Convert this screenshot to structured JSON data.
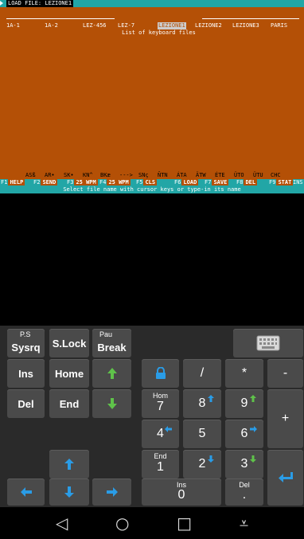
{
  "terminal": {
    "title": "LOAD FILE: LEZIONE1",
    "list_title": "List of keyboard files",
    "files": [
      "1A-1",
      "1A-2",
      "LEZ-456",
      "LEZ-7",
      "LEZIONE1",
      "LEZIONE2",
      "LEZIONE3",
      "PARIS"
    ],
    "selected_file": "LEZIONE1",
    "accents": [
      "ASß",
      "AR•",
      "SK•",
      "KN^",
      "BKæ",
      "--->",
      "SNç",
      "ÑTN",
      "ÁTA",
      "ÄTW",
      "ÉTE",
      "ÜTO",
      "ÜTU",
      "CHC"
    ],
    "function_keys": [
      {
        "num": "F1",
        "label": "HELP"
      },
      {
        "num": "F2",
        "label": "SEND"
      },
      {
        "num": "F3",
        "label": "25 WPM"
      },
      {
        "num": "F4",
        "label": "25 WPM"
      },
      {
        "num": "F5",
        "label": "CLS"
      },
      {
        "num": "F6",
        "label": "LOAD"
      },
      {
        "num": "F7",
        "label": "SAVE"
      },
      {
        "num": "F8",
        "label": "DEL"
      },
      {
        "num": "F9",
        "label": "STAT"
      }
    ],
    "ins_label": "INS",
    "status": "Select file name with cursor keys or type-in its name"
  },
  "keyboard": {
    "sysrq_top": "P.S",
    "sysrq": "Sysrq",
    "slock": "S.Lock",
    "break_top": "Pau",
    "break": "Break",
    "ins": "Ins",
    "home": "Home",
    "del": "Del",
    "end": "End",
    "slash": "/",
    "star": "*",
    "minus": "-",
    "plus": "+",
    "n7_top": "Hom",
    "n7": "7",
    "n8": "8",
    "n9": "9",
    "n4": "4",
    "n5": "5",
    "n6": "6",
    "n1_top": "End",
    "n1": "1",
    "n2": "2",
    "n3": "3",
    "n0_top": "Ins",
    "n0": "0",
    "dot_top": "Del",
    "dot": "."
  },
  "nav": {
    "back": "◁",
    "home": "○",
    "recents": "□",
    "menu": "⩡"
  }
}
